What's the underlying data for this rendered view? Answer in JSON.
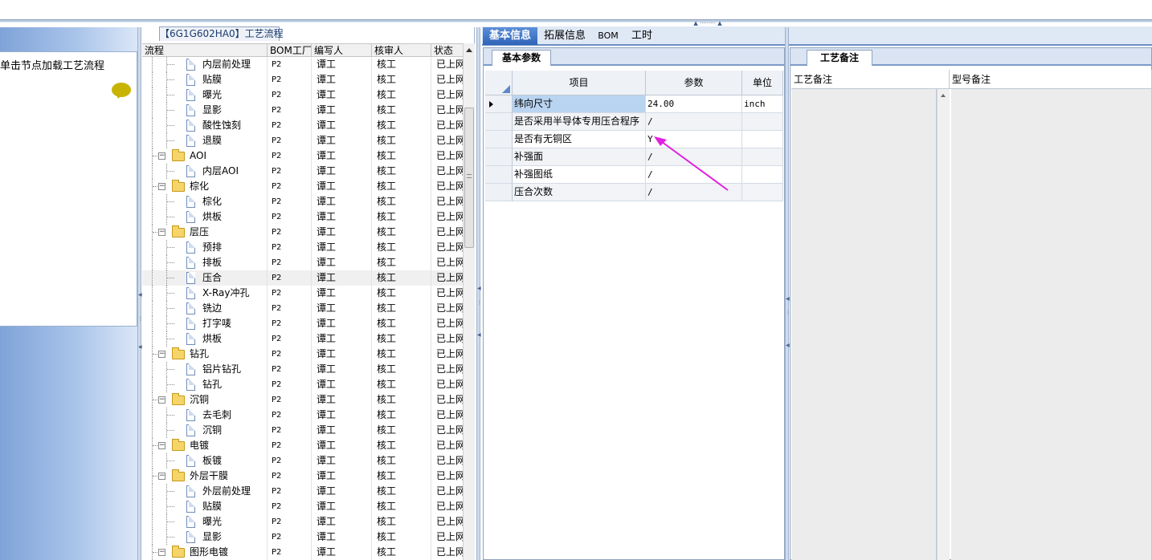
{
  "left_panel": {
    "tip": "单击节点加载工艺流程"
  },
  "tree_panel": {
    "title": "【6G1G602HA0】工艺流程",
    "columns": [
      "流程",
      "BOM工厂",
      "编写人",
      "核审人",
      "状态"
    ],
    "rows": [
      {
        "label": "内层前处理",
        "type": "doc",
        "factory": "P2",
        "writer": "谭工",
        "reviewer": "核工",
        "status": "已上网"
      },
      {
        "label": "贴膜",
        "type": "doc",
        "factory": "P2",
        "writer": "谭工",
        "reviewer": "核工",
        "status": "已上网"
      },
      {
        "label": "曝光",
        "type": "doc",
        "factory": "P2",
        "writer": "谭工",
        "reviewer": "核工",
        "status": "已上网"
      },
      {
        "label": "显影",
        "type": "doc",
        "factory": "P2",
        "writer": "谭工",
        "reviewer": "核工",
        "status": "已上网"
      },
      {
        "label": "酸性蚀刻",
        "type": "doc",
        "factory": "P2",
        "writer": "谭工",
        "reviewer": "核工",
        "status": "已上网"
      },
      {
        "label": "退膜",
        "type": "doc",
        "factory": "P2",
        "writer": "谭工",
        "reviewer": "核工",
        "status": "已上网"
      },
      {
        "label": "AOI",
        "type": "folder",
        "factory": "P2",
        "writer": "谭工",
        "reviewer": "核工",
        "status": "已上网"
      },
      {
        "label": "内层AOI",
        "type": "doc",
        "factory": "P2",
        "writer": "谭工",
        "reviewer": "核工",
        "status": "已上网"
      },
      {
        "label": "棕化",
        "type": "folder",
        "factory": "P2",
        "writer": "谭工",
        "reviewer": "核工",
        "status": "已上网"
      },
      {
        "label": "棕化",
        "type": "doc",
        "factory": "P2",
        "writer": "谭工",
        "reviewer": "核工",
        "status": "已上网"
      },
      {
        "label": "烘板",
        "type": "doc",
        "factory": "P2",
        "writer": "谭工",
        "reviewer": "核工",
        "status": "已上网"
      },
      {
        "label": "层压",
        "type": "folder",
        "factory": "P2",
        "writer": "谭工",
        "reviewer": "核工",
        "status": "已上网"
      },
      {
        "label": "预排",
        "type": "doc",
        "factory": "P2",
        "writer": "谭工",
        "reviewer": "核工",
        "status": "已上网"
      },
      {
        "label": "排板",
        "type": "doc",
        "factory": "P2",
        "writer": "谭工",
        "reviewer": "核工",
        "status": "已上网"
      },
      {
        "label": "压合",
        "type": "doc",
        "factory": "P2",
        "writer": "谭工",
        "reviewer": "核工",
        "status": "已上网",
        "selected": true
      },
      {
        "label": "X-Ray冲孔",
        "type": "doc",
        "factory": "P2",
        "writer": "谭工",
        "reviewer": "核工",
        "status": "已上网"
      },
      {
        "label": "铣边",
        "type": "doc",
        "factory": "P2",
        "writer": "谭工",
        "reviewer": "核工",
        "status": "已上网"
      },
      {
        "label": "打字唛",
        "type": "doc",
        "factory": "P2",
        "writer": "谭工",
        "reviewer": "核工",
        "status": "已上网"
      },
      {
        "label": "烘板",
        "type": "doc",
        "factory": "P2",
        "writer": "谭工",
        "reviewer": "核工",
        "status": "已上网"
      },
      {
        "label": "钻孔",
        "type": "folder",
        "factory": "P2",
        "writer": "谭工",
        "reviewer": "核工",
        "status": "已上网"
      },
      {
        "label": "铝片钻孔",
        "type": "doc",
        "factory": "P2",
        "writer": "谭工",
        "reviewer": "核工",
        "status": "已上网"
      },
      {
        "label": "钻孔",
        "type": "doc",
        "factory": "P2",
        "writer": "谭工",
        "reviewer": "核工",
        "status": "已上网"
      },
      {
        "label": "沉铜",
        "type": "folder",
        "factory": "P2",
        "writer": "谭工",
        "reviewer": "核工",
        "status": "已上网"
      },
      {
        "label": "去毛刺",
        "type": "doc",
        "factory": "P2",
        "writer": "谭工",
        "reviewer": "核工",
        "status": "已上网"
      },
      {
        "label": "沉铜",
        "type": "doc",
        "factory": "P2",
        "writer": "谭工",
        "reviewer": "核工",
        "status": "已上网"
      },
      {
        "label": "电镀",
        "type": "folder",
        "factory": "P2",
        "writer": "谭工",
        "reviewer": "核工",
        "status": "已上网"
      },
      {
        "label": "板镀",
        "type": "doc",
        "factory": "P2",
        "writer": "谭工",
        "reviewer": "核工",
        "status": "已上网"
      },
      {
        "label": "外层干膜",
        "type": "folder",
        "factory": "P2",
        "writer": "谭工",
        "reviewer": "核工",
        "status": "已上网"
      },
      {
        "label": "外层前处理",
        "type": "doc",
        "factory": "P2",
        "writer": "谭工",
        "reviewer": "核工",
        "status": "已上网"
      },
      {
        "label": "贴膜",
        "type": "doc",
        "factory": "P2",
        "writer": "谭工",
        "reviewer": "核工",
        "status": "已上网"
      },
      {
        "label": "曝光",
        "type": "doc",
        "factory": "P2",
        "writer": "谭工",
        "reviewer": "核工",
        "status": "已上网"
      },
      {
        "label": "显影",
        "type": "doc",
        "factory": "P2",
        "writer": "谭工",
        "reviewer": "核工",
        "status": "已上网"
      },
      {
        "label": "图形电镀",
        "type": "folder",
        "factory": "P2",
        "writer": "谭工",
        "reviewer": "核工",
        "status": "已上网"
      }
    ]
  },
  "main_tabs": [
    "基本信息",
    "拓展信息",
    "BOM",
    "工时"
  ],
  "params_panel": {
    "tab": "基本参数",
    "columns": [
      "项目",
      "参数",
      "单位"
    ],
    "rows": [
      {
        "item": "纬向尺寸",
        "value": "24.00",
        "unit": "inch"
      },
      {
        "item": "是否采用半导体专用压合程序",
        "value": "/",
        "unit": ""
      },
      {
        "item": "是否有无铜区",
        "value": "Y",
        "unit": ""
      },
      {
        "item": "补强面",
        "value": "/",
        "unit": ""
      },
      {
        "item": "补强图纸",
        "value": "/",
        "unit": ""
      },
      {
        "item": "压合次数",
        "value": "/",
        "unit": ""
      }
    ]
  },
  "notes_panel": {
    "tab": "工艺备注",
    "columns": [
      "工艺备注",
      "型号备注"
    ]
  },
  "colors": {
    "accent": "#2e63b8",
    "annotation_arrow": "#e020e0",
    "selected_cell": "#b9d4f1"
  }
}
